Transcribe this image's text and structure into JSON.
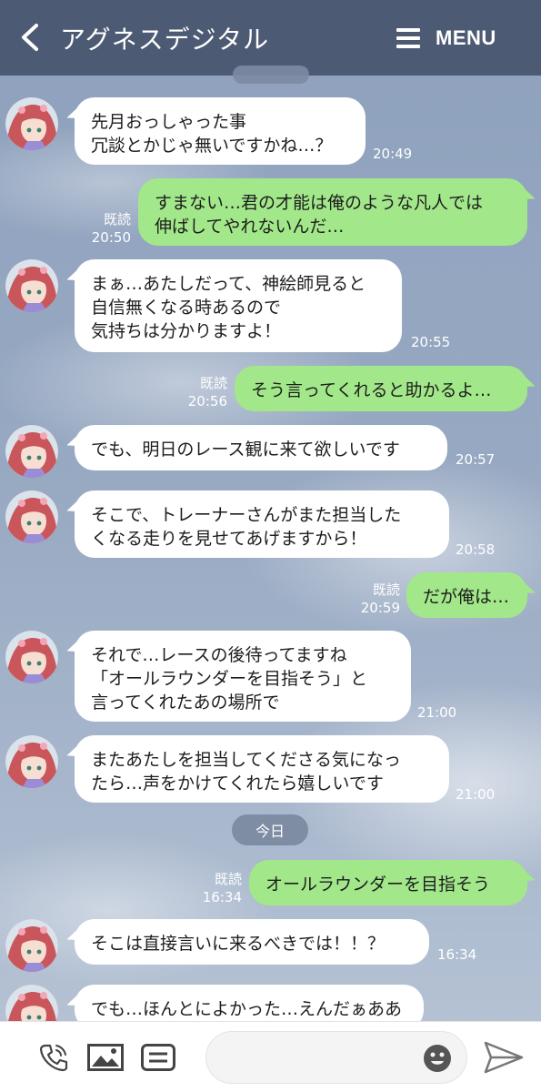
{
  "header": {
    "back_icon": "chevron-left-icon",
    "title": "アグネスデジタル",
    "menu_icon": "hamburger-icon",
    "menu_label": "MENU"
  },
  "colors": {
    "header_bg": "#4d5a73",
    "bubble_in": "#ffffff",
    "bubble_out": "#a2e88a",
    "text": "#1d1d1d"
  },
  "messages": [
    {
      "dir": "in",
      "text": "先月おっしゃった事\n冗談とかじゃ無いですかね…？",
      "time": "20:49"
    },
    {
      "dir": "out",
      "text": "すまない…君の才能は俺のような凡人では\n伸ばしてやれないんだ…",
      "read": "既読",
      "time": "20:50"
    },
    {
      "dir": "in",
      "text": "まぁ…あたしだって、神絵師見ると\n自信無くなる時あるので\n気持ちは分かりますよ！",
      "time": "20:55"
    },
    {
      "dir": "out",
      "text": "そう言ってくれると助かるよ…",
      "read": "既読",
      "time": "20:56"
    },
    {
      "dir": "in",
      "text": "でも、明日のレース観に来て欲しいです",
      "time": "20:57"
    },
    {
      "dir": "in",
      "text": "そこで、トレーナーさんがまた担当した\nくなる走りを見せてあげますから！",
      "time": "20:58"
    },
    {
      "dir": "out",
      "text": "だが俺は…",
      "read": "既読",
      "time": "20:59"
    },
    {
      "dir": "in",
      "text": "それで…レースの後待ってますね\n「オールラウンダーを目指そう」と\n言ってくれたあの場所で",
      "time": "21:00"
    },
    {
      "dir": "in",
      "text": "またあたしを担当してくださる気になっ\nたら…声をかけてくれたら嬉しいです",
      "time": "21:00"
    },
    {
      "dir": "out",
      "text": "オールラウンダーを目指そう",
      "read": "既読",
      "time": "16:34"
    },
    {
      "dir": "in",
      "text": "そこは直接言いに来るべきでは！！？",
      "time": "16:34"
    },
    {
      "dir": "in",
      "text": "でも…ほんとによかった…えんだぁああ",
      "time": ""
    }
  ],
  "date_divider": "今日",
  "footer": {
    "call_icon": "phone-icon",
    "image_icon": "image-icon",
    "text_icon": "keyboard-icon",
    "emoji_icon": "emoji-icon",
    "send_icon": "send-icon",
    "input_value": ""
  }
}
